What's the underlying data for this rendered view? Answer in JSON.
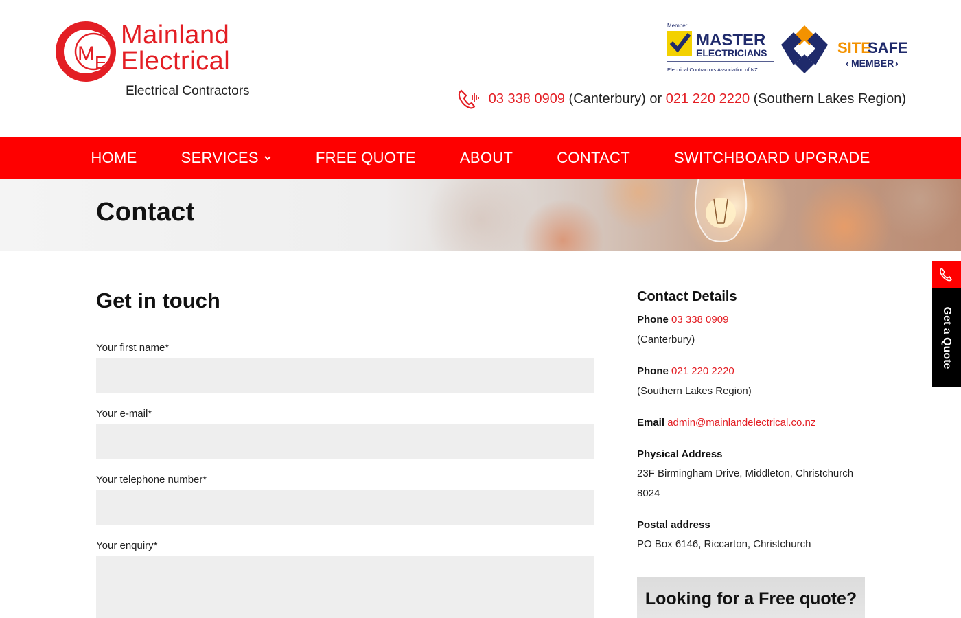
{
  "brand": {
    "name_line1": "Mainland",
    "name_line2": "Electrical",
    "tagline": "Electrical Contractors",
    "mark_letters": "ME"
  },
  "badges": {
    "mec_member": "Member",
    "mec_line1": "MASTER",
    "mec_line2": "ELECTRICIANS",
    "mec_sub": "Electrical Contractors Association of NZ",
    "sitesafe_a": "SITE",
    "sitesafe_b": "SAFE",
    "sitesafe_member": "MEMBER"
  },
  "header_phone": {
    "phone1": "03 338 0909",
    "region1": "(Canterbury)",
    "joiner": "or",
    "phone2": "021 220 2220",
    "region2": "(Southern Lakes Region)"
  },
  "nav": {
    "items": [
      "HOME",
      "SERVICES",
      "FREE QUOTE",
      "ABOUT",
      "CONTACT",
      "SWITCHBOARD UPGRADE"
    ]
  },
  "hero": {
    "title": "Contact"
  },
  "form": {
    "heading": "Get in touch",
    "first_name_label": "Your first name*",
    "email_label": "Your e-mail*",
    "phone_label": "Your telephone number*",
    "enquiry_label": "Your enquiry*",
    "first_name_value": "",
    "email_value": "",
    "phone_value": "",
    "enquiry_value": ""
  },
  "contact_details": {
    "title": "Contact Details",
    "phone_label": "Phone",
    "phone1": "03 338 0909",
    "phone1_region": "(Canterbury)",
    "phone2": "021 220 2220",
    "phone2_region": "(Southern Lakes Region)",
    "email_label": "Email",
    "email": "admin@mainlandelectrical.co.nz",
    "physical_label": "Physical Address",
    "physical_line1": "23F Birmingham Drive, Middleton, Christchurch",
    "physical_line2": "8024",
    "postal_label": "Postal address",
    "postal": "PO Box 6146, Riccarton, Christchurch"
  },
  "quote_box": {
    "title": "Looking for a Free quote?"
  },
  "side_tab": {
    "label": "Get a Quote"
  },
  "colors": {
    "brand_red": "#e31e24",
    "nav_red": "#fe0000",
    "field_bg": "#eeeeee"
  }
}
